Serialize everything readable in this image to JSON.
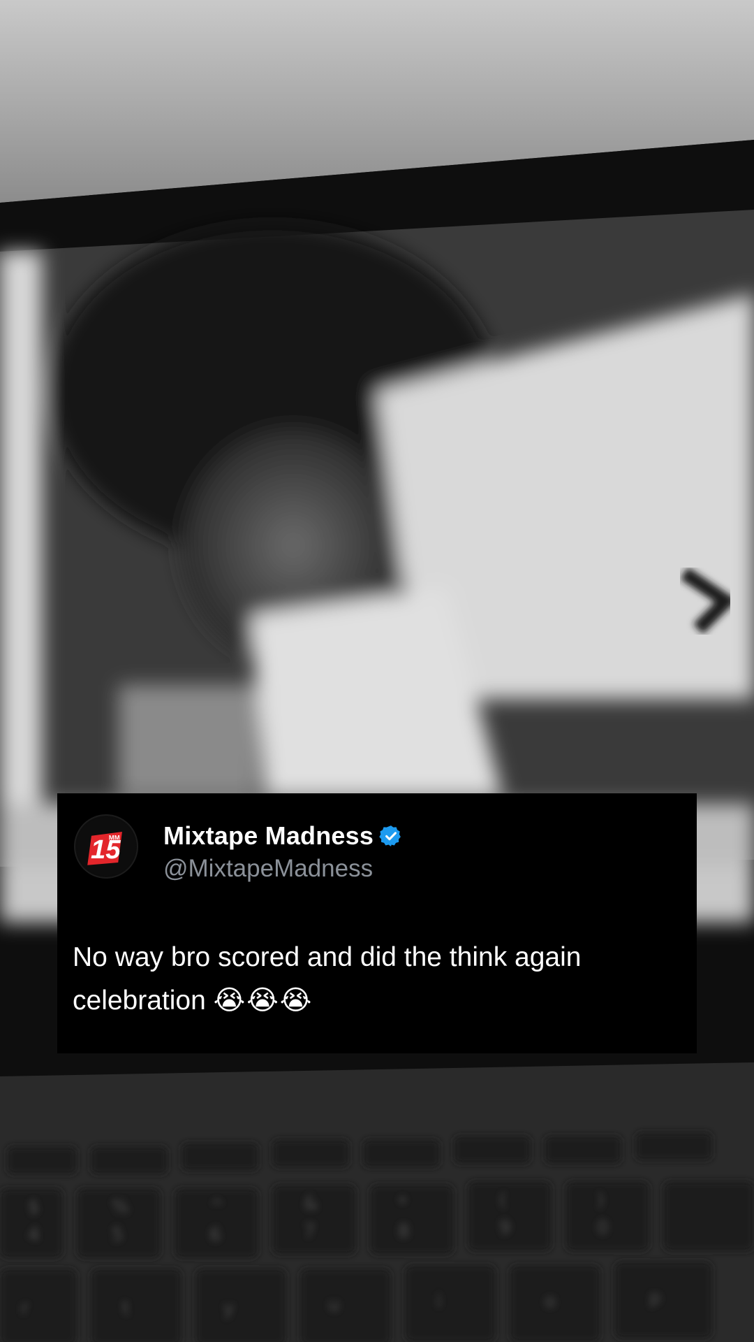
{
  "tweet": {
    "display_name": "Mixtape Madness",
    "handle": "@MixtapeMadness",
    "verified": true,
    "avatar_text": "15",
    "avatar_badge_text": "MM",
    "text": "No way bro scored and did the think again celebration",
    "emojis": "😭😭😭"
  },
  "keyboard": {
    "keys": [
      "$",
      "4",
      "%",
      "5",
      "^",
      "6",
      "&",
      "7",
      "*",
      "8",
      "(",
      "9",
      ")",
      "0",
      "r",
      "t",
      "y",
      "u",
      "i",
      "o",
      "p"
    ]
  },
  "colors": {
    "card_bg": "#000000",
    "verified": "#1d9bf0",
    "handle": "#8b9199",
    "avatar_red": "#e3262b"
  }
}
